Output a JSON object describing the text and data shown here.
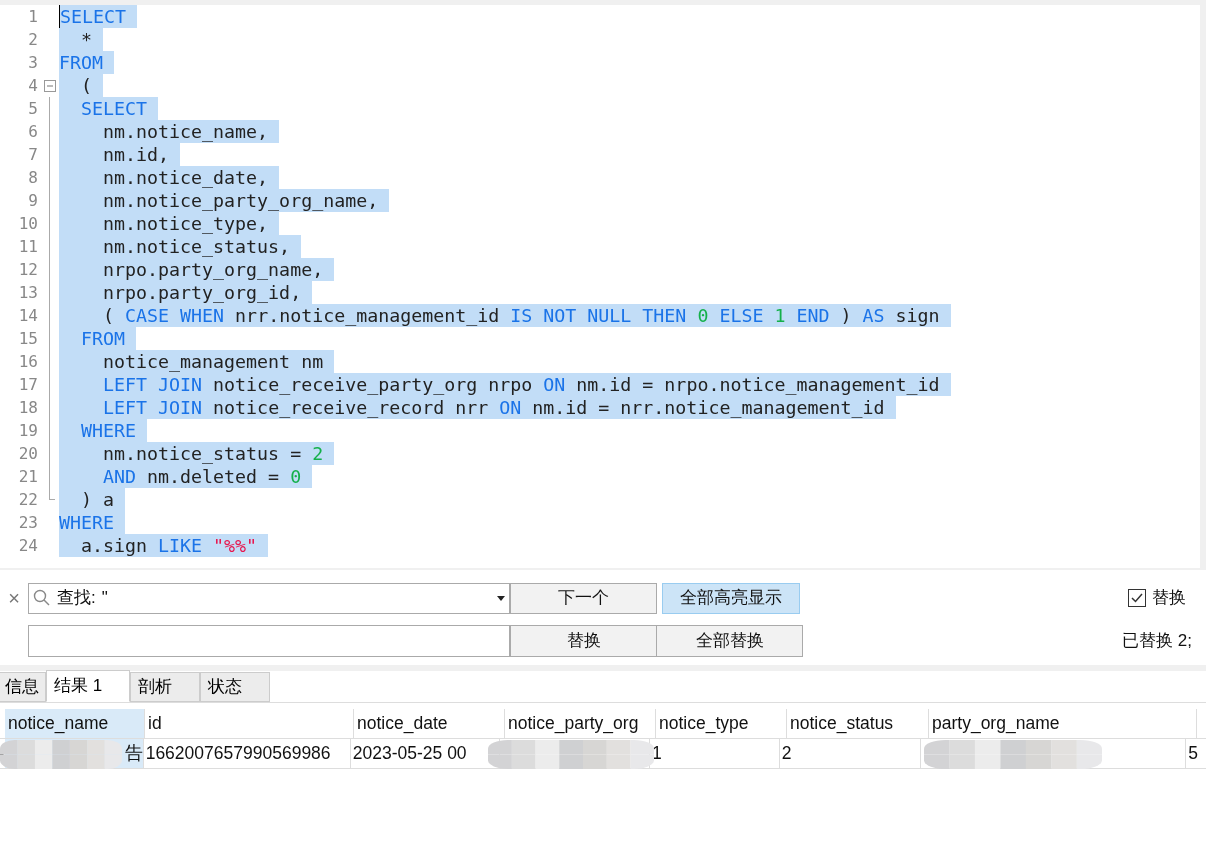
{
  "editor": {
    "lines": [
      {
        "number": "1",
        "tokens": [
          {
            "kind": "kw",
            "text": "SELECT"
          }
        ]
      },
      {
        "number": "2",
        "tokens": [
          {
            "kind": "plain",
            "text": "  *"
          }
        ]
      },
      {
        "number": "3",
        "tokens": [
          {
            "kind": "kw",
            "text": "FROM"
          }
        ]
      },
      {
        "number": "4",
        "expanded": true,
        "tokens": [
          {
            "kind": "plain",
            "text": "  ("
          }
        ],
        "children": [
          {
            "number": "5",
            "tokens": [
              {
                "kind": "kw",
                "text": "  SELECT"
              }
            ]
          },
          {
            "number": "6",
            "tokens": [
              {
                "kind": "plain",
                "text": "    nm.notice_name,"
              }
            ]
          },
          {
            "number": "7",
            "tokens": [
              {
                "kind": "plain",
                "text": "    nm.id,"
              }
            ]
          },
          {
            "number": "8",
            "tokens": [
              {
                "kind": "plain",
                "text": "    nm.notice_date,"
              }
            ]
          },
          {
            "number": "9",
            "tokens": [
              {
                "kind": "plain",
                "text": "    nm.notice_party_org_name,"
              }
            ]
          },
          {
            "number": "10",
            "tokens": [
              {
                "kind": "plain",
                "text": "    nm.notice_type,"
              }
            ]
          },
          {
            "number": "11",
            "tokens": [
              {
                "kind": "plain",
                "text": "    nm.notice_status,"
              }
            ]
          },
          {
            "number": "12",
            "tokens": [
              {
                "kind": "plain",
                "text": "    nrpo.party_org_name,"
              }
            ]
          },
          {
            "number": "13",
            "tokens": [
              {
                "kind": "plain",
                "text": "    nrpo.party_org_id,"
              }
            ]
          },
          {
            "number": "14",
            "tokens": [
              {
                "kind": "plain",
                "text": "    ( "
              },
              {
                "kind": "kw",
                "text": "CASE WHEN"
              },
              {
                "kind": "plain",
                "text": " nrr.notice_management_id "
              },
              {
                "kind": "kw",
                "text": "IS NOT NULL THEN "
              },
              {
                "kind": "num",
                "text": "0"
              },
              {
                "kind": "kw",
                "text": " ELSE "
              },
              {
                "kind": "num",
                "text": "1"
              },
              {
                "kind": "kw",
                "text": " END"
              },
              {
                "kind": "plain",
                "text": " ) "
              },
              {
                "kind": "kw",
                "text": "AS"
              },
              {
                "kind": "plain",
                "text": " sign"
              }
            ]
          },
          {
            "number": "15",
            "tokens": [
              {
                "kind": "kw",
                "text": "  FROM"
              }
            ]
          },
          {
            "number": "16",
            "tokens": [
              {
                "kind": "plain",
                "text": "    notice_management nm"
              }
            ]
          },
          {
            "number": "17",
            "tokens": [
              {
                "kind": "kw",
                "text": "    LEFT JOIN"
              },
              {
                "kind": "plain",
                "text": " notice_receive_party_org nrpo "
              },
              {
                "kind": "kw",
                "text": "ON"
              },
              {
                "kind": "plain",
                "text": " nm.id = nrpo.notice_management_id"
              }
            ]
          },
          {
            "number": "18",
            "tokens": [
              {
                "kind": "kw",
                "text": "    LEFT JOIN"
              },
              {
                "kind": "plain",
                "text": " notice_receive_record nrr "
              },
              {
                "kind": "kw",
                "text": "ON"
              },
              {
                "kind": "plain",
                "text": " nm.id = nrr.notice_management_id"
              }
            ]
          },
          {
            "number": "19",
            "tokens": [
              {
                "kind": "kw",
                "text": "  WHERE"
              }
            ]
          },
          {
            "number": "20",
            "tokens": [
              {
                "kind": "plain",
                "text": "    nm.notice_status = "
              },
              {
                "kind": "num",
                "text": "2"
              }
            ]
          },
          {
            "number": "21",
            "tokens": [
              {
                "kind": "kw",
                "text": "    AND"
              },
              {
                "kind": "plain",
                "text": " nm.deleted = "
              },
              {
                "kind": "num",
                "text": "0"
              }
            ]
          },
          {
            "number": "22",
            "tokens": [
              {
                "kind": "plain",
                "text": "  ) a"
              }
            ]
          }
        ]
      },
      {
        "number": "23",
        "tokens": [
          {
            "kind": "kw",
            "text": "WHERE"
          }
        ]
      },
      {
        "number": "24",
        "tokens": [
          {
            "kind": "plain",
            "text": "  a.sign "
          },
          {
            "kind": "kw",
            "text": "LIKE "
          },
          {
            "kind": "str",
            "text": "\"%%\""
          }
        ]
      }
    ]
  },
  "find_bar": {
    "close": "×",
    "find_label": "查找:",
    "find_value": "\"",
    "next_button": "下一个",
    "highlight_all_button": {
      "label": "全部高亮显示",
      "pressed": true
    },
    "replace_checkbox": {
      "label": "替换",
      "checked": true
    },
    "replace_button": "替换",
    "replace_all_button": "全部替换",
    "status": "已替换 2;"
  },
  "result_tabs": [
    {
      "label": "信息",
      "selected": false
    },
    {
      "label": "结果 1",
      "selected": true
    },
    {
      "label": "剖析",
      "selected": false
    },
    {
      "label": "状态",
      "selected": false
    }
  ],
  "grid": {
    "columns": [
      {
        "label": "notice_name",
        "selected": true
      },
      {
        "label": "id",
        "selected": false
      },
      {
        "label": "notice_date",
        "selected": false
      },
      {
        "label": "notice_party_org",
        "selected": false
      },
      {
        "label": "notice_type",
        "selected": false
      },
      {
        "label": "notice_status",
        "selected": false
      },
      {
        "label": "party_org_name",
        "selected": false
      }
    ],
    "rows": [
      {
        "current": true,
        "cells": [
          "告",
          "1662007657990569986",
          "2023-05-25 00",
          "",
          "1",
          "2",
          "",
          "5"
        ]
      }
    ]
  }
}
